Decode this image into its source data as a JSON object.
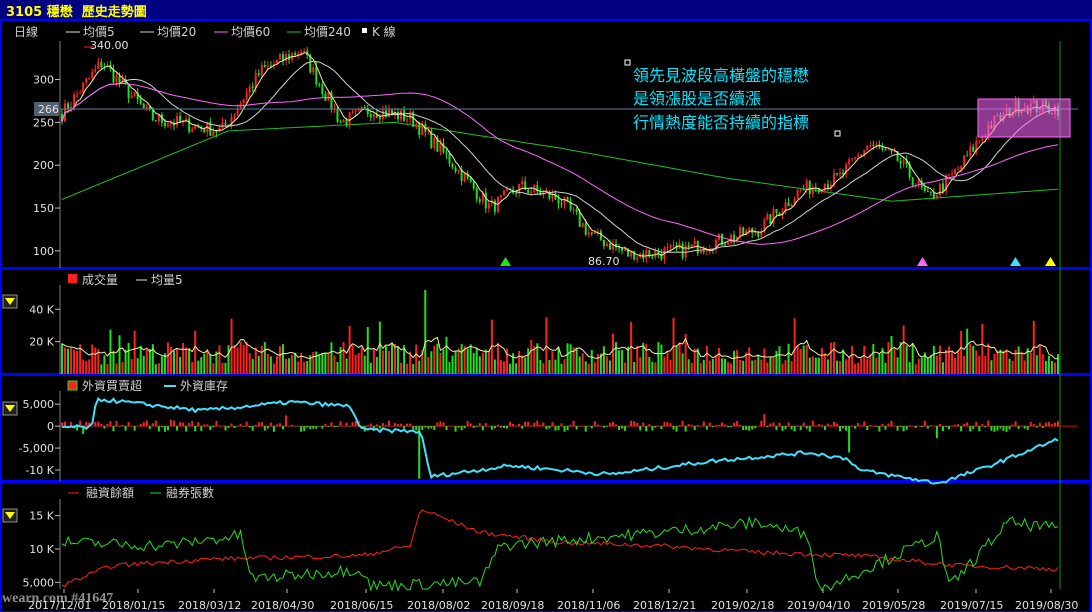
{
  "window": {
    "title": "3105 穩懋  歷史走勢圖"
  },
  "watermark": "wearn.com #41647",
  "colors": {
    "up": "#ff2020",
    "down": "#20e020",
    "ma5": "#f0f0a0",
    "ma20": "#d0d0d0",
    "ma60": "#ff66ff",
    "ma240": "#20c020",
    "inventory": "#40e0ff",
    "highlight": "#ff66ff",
    "panel_border": "#0000ff"
  },
  "x_labels": [
    "2017/12/01",
    "2018/01/15",
    "2018/03/12",
    "2018/04/30",
    "2018/06/15",
    "2018/08/02",
    "2018/09/18",
    "2018/11/06",
    "2018/12/21",
    "2019/02/18",
    "2019/04/10",
    "2019/05/28",
    "2019/07/15",
    "2019/08/30"
  ],
  "panels": {
    "price": {
      "legend": [
        "日線",
        "均價5",
        "均價20",
        "均價60",
        "均價240",
        "K 線"
      ],
      "current_value": "266",
      "max_label": "340.00",
      "min_label": "86.70",
      "annotation": [
        "領先見波段高橫盤的穩懋",
        "是領漲股是否續漲",
        "行情熱度能否持續的指標"
      ]
    },
    "volume": {
      "legend": [
        "成交量",
        "均量5"
      ]
    },
    "foreign": {
      "legend": [
        "外資買賣超",
        "外資庫存"
      ]
    },
    "margin": {
      "legend": [
        "融資餘額",
        "融券張數"
      ]
    }
  },
  "chart_data": [
    {
      "type": "candlestick",
      "title": "3105 穩懋 日線",
      "ylim": [
        80,
        345
      ],
      "yticks": [
        100,
        150,
        200,
        250,
        300
      ],
      "series": [
        {
          "name": "收盤價",
          "dates": [
            "2017/12/01",
            "2018/01/15",
            "2018/03/12",
            "2018/04/30",
            "2018/06/15",
            "2018/08/02",
            "2018/09/18",
            "2018/11/06",
            "2018/12/21",
            "2019/02/18",
            "2019/04/10",
            "2019/05/28",
            "2019/07/15",
            "2019/08/30"
          ],
          "values": [
            290,
            250,
            305,
            250,
            260,
            150,
            160,
            95,
            115,
            175,
            225,
            160,
            260,
            266
          ]
        },
        {
          "name": "均價240",
          "dates": [
            "2017/12/01",
            "2018/04/30",
            "2018/08/02",
            "2018/11/06",
            "2019/02/18",
            "2019/05/28",
            "2019/08/30"
          ],
          "values": [
            160,
            240,
            250,
            220,
            185,
            158,
            172
          ]
        }
      ],
      "max": {
        "date": "2018/04/30",
        "value": 340.0
      },
      "min": {
        "date": "2018/11/06",
        "value": 86.7
      }
    },
    {
      "type": "bar",
      "title": "成交量",
      "ylim": [
        0,
        55000
      ],
      "yticks": [
        {
          "v": 20000,
          "label": "20 K"
        },
        {
          "v": 40000,
          "label": "40 K"
        }
      ]
    },
    {
      "type": "bar",
      "title": "外資買賣超 / 外資庫存",
      "ylim": [
        -12500,
        8000
      ],
      "yticks": [
        {
          "v": 5000,
          "label": "5,000"
        },
        {
          "v": 0,
          "label": "0"
        },
        {
          "v": -5000,
          "label": "-5,000"
        },
        {
          "v": -10000,
          "label": "-10 K"
        }
      ]
    },
    {
      "type": "line",
      "title": "融資餘額 / 融券張數",
      "ylim": [
        4000,
        17500
      ],
      "yticks": [
        {
          "v": 5000,
          "label": "5,000"
        },
        {
          "v": 10000,
          "label": "10 K"
        },
        {
          "v": 15000,
          "label": "15 K"
        }
      ]
    }
  ]
}
